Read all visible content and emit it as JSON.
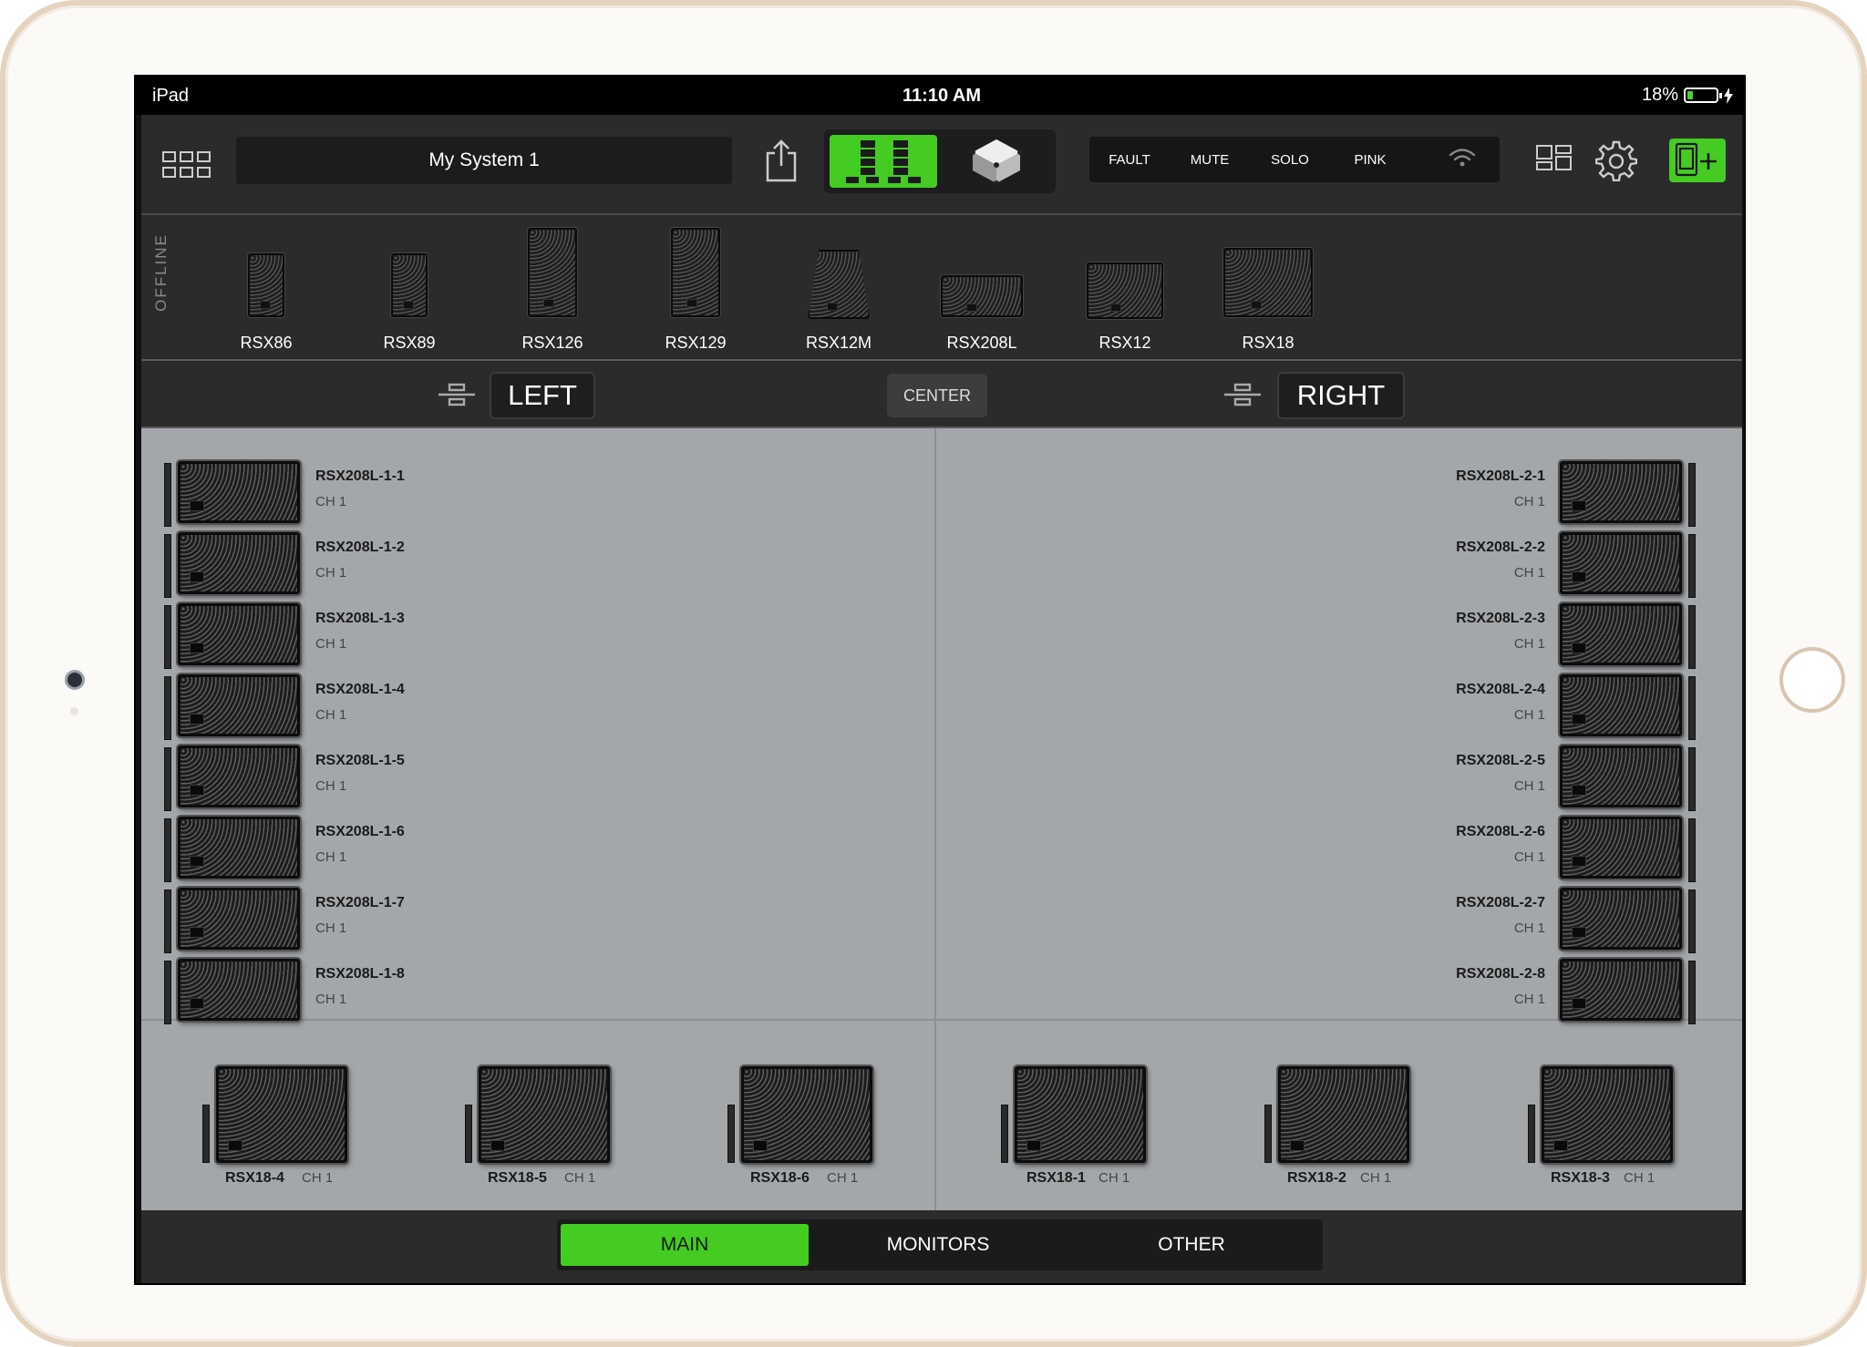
{
  "status_bar": {
    "device": "iPad",
    "time": "11:10 AM",
    "battery": "18%"
  },
  "toolbar": {
    "system_name": "My System 1",
    "controls": [
      "FAULT",
      "MUTE",
      "SOLO",
      "PINK"
    ]
  },
  "offline": {
    "label": "OFFLINE",
    "models": [
      "RSX86",
      "RSX89",
      "RSX126",
      "RSX129",
      "RSX12M",
      "RSX208L",
      "RSX12",
      "RSX18"
    ]
  },
  "zones": {
    "left": "LEFT",
    "center": "CENTER",
    "right": "RIGHT"
  },
  "left_column": [
    {
      "name": "RSX208L-1-1",
      "ch": "CH 1"
    },
    {
      "name": "RSX208L-1-2",
      "ch": "CH 1"
    },
    {
      "name": "RSX208L-1-3",
      "ch": "CH 1"
    },
    {
      "name": "RSX208L-1-4",
      "ch": "CH 1"
    },
    {
      "name": "RSX208L-1-5",
      "ch": "CH 1"
    },
    {
      "name": "RSX208L-1-6",
      "ch": "CH 1"
    },
    {
      "name": "RSX208L-1-7",
      "ch": "CH 1"
    },
    {
      "name": "RSX208L-1-8",
      "ch": "CH 1"
    }
  ],
  "right_column": [
    {
      "name": "RSX208L-2-1",
      "ch": "CH 1"
    },
    {
      "name": "RSX208L-2-2",
      "ch": "CH 1"
    },
    {
      "name": "RSX208L-2-3",
      "ch": "CH 1"
    },
    {
      "name": "RSX208L-2-4",
      "ch": "CH 1"
    },
    {
      "name": "RSX208L-2-5",
      "ch": "CH 1"
    },
    {
      "name": "RSX208L-2-6",
      "ch": "CH 1"
    },
    {
      "name": "RSX208L-2-7",
      "ch": "CH 1"
    },
    {
      "name": "RSX208L-2-8",
      "ch": "CH 1"
    }
  ],
  "subwoofers": [
    {
      "name": "RSX18-4",
      "ch": "CH 1"
    },
    {
      "name": "RSX18-5",
      "ch": "CH 1"
    },
    {
      "name": "RSX18-6",
      "ch": "CH 1"
    },
    {
      "name": "RSX18-1",
      "ch": "CH 1"
    },
    {
      "name": "RSX18-2",
      "ch": "CH 1"
    },
    {
      "name": "RSX18-3",
      "ch": "CH 1"
    }
  ],
  "tabs": [
    "MAIN",
    "MONITORS",
    "OTHER"
  ],
  "colors": {
    "accent": "#44cc22",
    "panel": "#2b2b2b",
    "stage": "#a4a7aa"
  }
}
